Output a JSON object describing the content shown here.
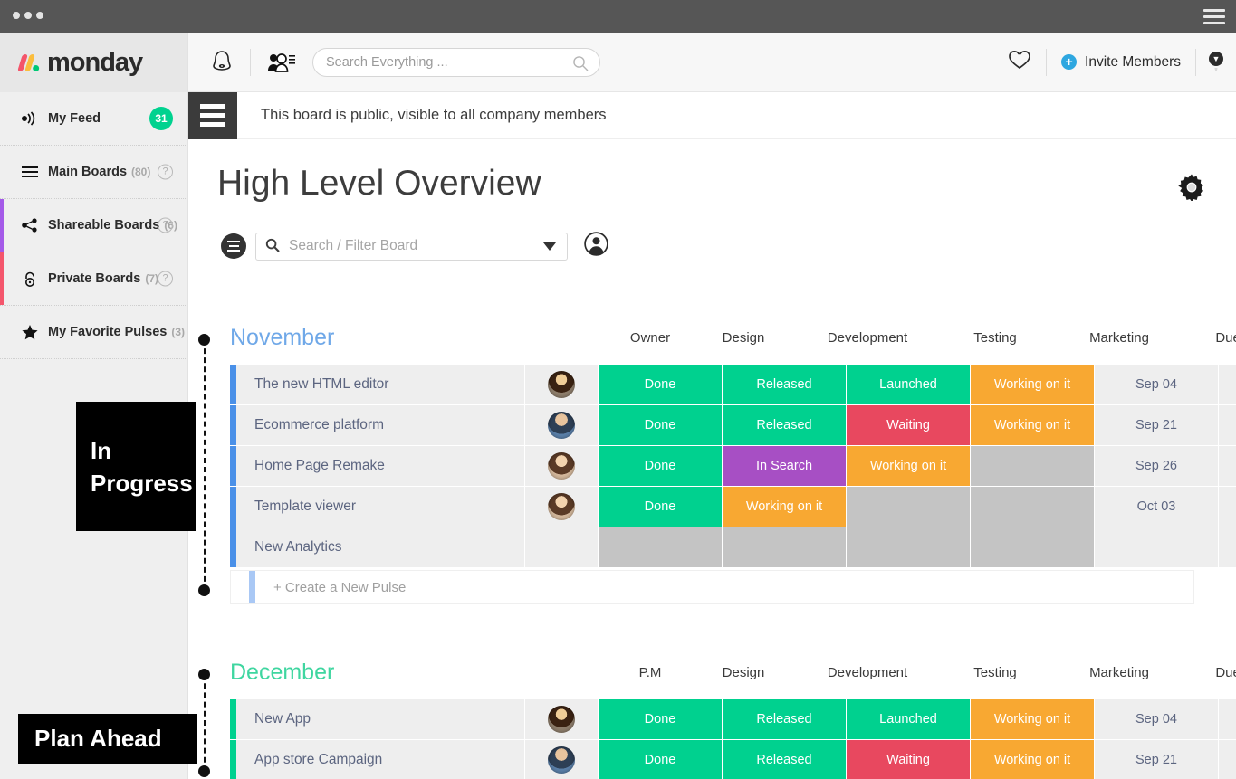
{
  "window": {
    "dots": 3,
    "menu_icon": "hamburger-icon"
  },
  "sidebar": {
    "logo_text": "monday",
    "items": [
      {
        "label": "My Feed",
        "icon": "feed-icon",
        "badge": "31",
        "count": "",
        "stripe": "",
        "help": false
      },
      {
        "label": "Main Boards",
        "icon": "list-icon",
        "count": "(80)",
        "stripe": "",
        "help": true
      },
      {
        "label": "Shareable Boards",
        "icon": "share-icon",
        "count": "(6)",
        "stripe": "#a45ae8",
        "help": true
      },
      {
        "label": "Private Boards",
        "icon": "lock-icon",
        "count": "(7)",
        "stripe": "#f4566c",
        "help": true
      },
      {
        "label": "My Favorite Pulses",
        "icon": "star-icon",
        "count": "(3)",
        "stripe": "",
        "help": false
      }
    ],
    "help_glyph": "?"
  },
  "topbar": {
    "bell_icon": "notification-bell-icon",
    "people_icon": "people-list-icon",
    "search_placeholder": "Search Everything ...",
    "search_value": "",
    "search_icon": "search-icon",
    "heart_icon": "heart-icon",
    "invite_label": "Invite Members",
    "invite_plus": "+",
    "avatar_icon": "user-avatar",
    "avatar_caret": "▼"
  },
  "notice": {
    "menu_icon": "board-menu-icon",
    "text": "This board is public, visible to all company members"
  },
  "board": {
    "title": "High Level Overview",
    "settings_icon": "gear-icon",
    "filter_icon": "filter-icon",
    "search_icon": "search-icon",
    "search_placeholder": "Search / Filter Board",
    "search_value": "",
    "caret_icon": "chevron-down-icon",
    "person_icon": "person-circle-icon",
    "add_column_icon": "plus-circle-icon",
    "new_pulse_label": "+ Create a New Pulse"
  },
  "colors": {
    "done": "#00d18f",
    "released": "#00d18f",
    "launched": "#00d18f",
    "working": "#f8a832",
    "waiting": "#e8485f",
    "in_search": "#a martin25bb4",
    "in_search_fixed": "#a css25bb4",
    "purple": "#a74fc4",
    "empty": "#c4c4c4",
    "blank": "#eeeeee",
    "november_accent": "#4a90e8",
    "december_accent": "#00d18f",
    "badge_green": "#00d28f",
    "invite_blue": "#2ea7e0"
  },
  "groups": [
    {
      "name": "November",
      "color": "#6fa8e8",
      "accent": "#4a90e8",
      "columns": [
        "Owner",
        "Design",
        "Development",
        "Testing",
        "Marketing",
        "Due Date"
      ],
      "rows": [
        {
          "name": "The new HTML editor",
          "owner": "avatar-1",
          "cells": [
            {
              "text": "Done",
              "color": "#00d18f"
            },
            {
              "text": "Released",
              "color": "#00d18f"
            },
            {
              "text": "Launched",
              "color": "#00d18f"
            },
            {
              "text": "Working on it",
              "color": "#f8a832"
            },
            {
              "text": "Sep 04",
              "color": "#eeeeee"
            },
            {
              "text": "",
              "color": "#eeeeee"
            }
          ]
        },
        {
          "name": "Ecommerce platform",
          "owner": "avatar-2",
          "cells": [
            {
              "text": "Done",
              "color": "#00d18f"
            },
            {
              "text": "Released",
              "color": "#00d18f"
            },
            {
              "text": "Waiting",
              "color": "#e8485f"
            },
            {
              "text": "Working on it",
              "color": "#f8a832"
            },
            {
              "text": "Sep 21",
              "color": "#eeeeee"
            },
            {
              "text": "",
              "color": "#eeeeee"
            }
          ]
        },
        {
          "name": "Home Page Remake",
          "owner": "avatar-3",
          "cells": [
            {
              "text": "Done",
              "color": "#00d18f"
            },
            {
              "text": "In Search",
              "color": "#a74fc4"
            },
            {
              "text": "Working on it",
              "color": "#f8a832"
            },
            {
              "text": "",
              "color": "#c4c4c4"
            },
            {
              "text": "Sep 26",
              "color": "#eeeeee"
            },
            {
              "text": "",
              "color": "#eeeeee"
            }
          ]
        },
        {
          "name": "Template viewer",
          "owner": "avatar-3",
          "cells": [
            {
              "text": "Done",
              "color": "#00d18f"
            },
            {
              "text": "Working on it",
              "color": "#f8a832"
            },
            {
              "text": "",
              "color": "#c4c4c4"
            },
            {
              "text": "",
              "color": "#c4c4c4"
            },
            {
              "text": "Oct 03",
              "color": "#eeeeee"
            },
            {
              "text": "",
              "color": "#eeeeee"
            }
          ]
        },
        {
          "name": "New Analytics",
          "owner": "",
          "cells": [
            {
              "text": "",
              "color": "#c4c4c4"
            },
            {
              "text": "",
              "color": "#c4c4c4"
            },
            {
              "text": "",
              "color": "#c4c4c4"
            },
            {
              "text": "",
              "color": "#c4c4c4"
            },
            {
              "text": "",
              "color": "#eeeeee"
            },
            {
              "text": "",
              "color": "#eeeeee"
            }
          ]
        }
      ]
    },
    {
      "name": "December",
      "color": "#3fd6a0",
      "accent": "#00d18f",
      "columns": [
        "P.M",
        "Design",
        "Development",
        "Testing",
        "Marketing",
        "Due Date"
      ],
      "rows": [
        {
          "name": "New App",
          "owner": "avatar-1",
          "cells": [
            {
              "text": "Done",
              "color": "#00d18f"
            },
            {
              "text": "Released",
              "color": "#00d18f"
            },
            {
              "text": "Launched",
              "color": "#00d18f"
            },
            {
              "text": "Working on it",
              "color": "#f8a832"
            },
            {
              "text": "Sep 04",
              "color": "#eeeeee"
            },
            {
              "text": "",
              "color": "#eeeeee"
            }
          ]
        },
        {
          "name": "App store Campaign",
          "owner": "avatar-2",
          "cells": [
            {
              "text": "Done",
              "color": "#00d18f"
            },
            {
              "text": "Released",
              "color": "#00d18f"
            },
            {
              "text": "Waiting",
              "color": "#e8485f"
            },
            {
              "text": "Working on it",
              "color": "#f8a832"
            },
            {
              "text": "Sep 21",
              "color": "#eeeeee"
            },
            {
              "text": "",
              "color": "#eeeeee"
            }
          ]
        }
      ]
    }
  ],
  "annotations": [
    {
      "id": "in-progress",
      "line1": "In",
      "line2": "Progress"
    },
    {
      "id": "plan-ahead",
      "line1": "Plan Ahead",
      "line2": ""
    }
  ]
}
